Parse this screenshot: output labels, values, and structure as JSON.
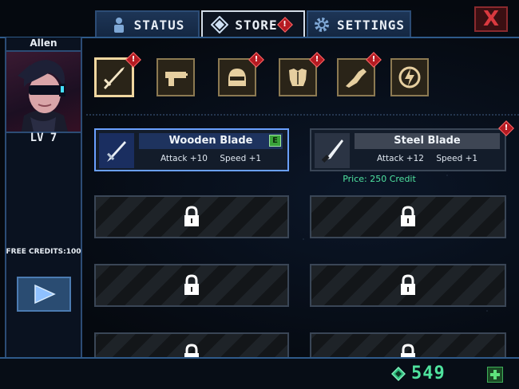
{
  "tabs": {
    "status": "STATUS",
    "store": "STORE",
    "settings": "SETTINGS",
    "store_badge": "!"
  },
  "close_label": "X",
  "player": {
    "name": "Allen",
    "level": "LV 7",
    "free_credits": "FREE CREDITS:100"
  },
  "categories": {
    "icons": [
      "sword-icon",
      "gun-icon",
      "helmet-icon",
      "armor-icon",
      "arm-icon",
      "energy-icon"
    ],
    "badge": "!"
  },
  "items": {
    "equipped": {
      "name": "Wooden Blade",
      "attack": "Attack +10",
      "speed": "Speed +1",
      "equipped_badge": "E"
    },
    "store": {
      "name": "Steel Blade",
      "attack": "Attack +12",
      "speed": "Speed +1",
      "price": "Price: 250 Credit",
      "badge": "!"
    }
  },
  "currency": {
    "amount": "549",
    "color": "#4fe39e"
  }
}
